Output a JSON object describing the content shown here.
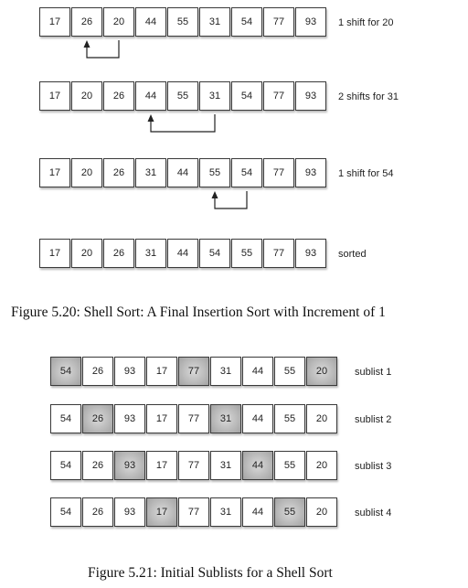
{
  "figure_5_20": {
    "caption": "Figure 5.20: Shell Sort: A Final Insertion Sort with Increment of 1",
    "rows": [
      {
        "values": [
          "17",
          "26",
          "20",
          "44",
          "55",
          "31",
          "54",
          "77",
          "93"
        ],
        "note": "1 shift for 20"
      },
      {
        "values": [
          "17",
          "20",
          "26",
          "44",
          "55",
          "31",
          "54",
          "77",
          "93"
        ],
        "note": "2 shifts for 31"
      },
      {
        "values": [
          "17",
          "20",
          "26",
          "31",
          "44",
          "55",
          "54",
          "77",
          "93"
        ],
        "note": "1 shift for 54"
      },
      {
        "values": [
          "17",
          "20",
          "26",
          "31",
          "44",
          "54",
          "55",
          "77",
          "93"
        ],
        "note": "sorted"
      }
    ]
  },
  "figure_5_21": {
    "caption": "Figure 5.21: Initial Sublists for a Shell Sort",
    "rows": [
      {
        "values": [
          "54",
          "26",
          "93",
          "17",
          "77",
          "31",
          "44",
          "55",
          "20"
        ],
        "note": "sublist 1",
        "highlighted": [
          0,
          4,
          8
        ]
      },
      {
        "values": [
          "54",
          "26",
          "93",
          "17",
          "77",
          "31",
          "44",
          "55",
          "20"
        ],
        "note": "sublist 2",
        "highlighted": [
          1,
          5
        ]
      },
      {
        "values": [
          "54",
          "26",
          "93",
          "17",
          "77",
          "31",
          "44",
          "55",
          "20"
        ],
        "note": "sublist 3",
        "highlighted": [
          2,
          6
        ]
      },
      {
        "values": [
          "54",
          "26",
          "93",
          "17",
          "77",
          "31",
          "44",
          "55",
          "20"
        ],
        "note": "sublist 4",
        "highlighted": [
          3,
          7
        ]
      }
    ]
  }
}
